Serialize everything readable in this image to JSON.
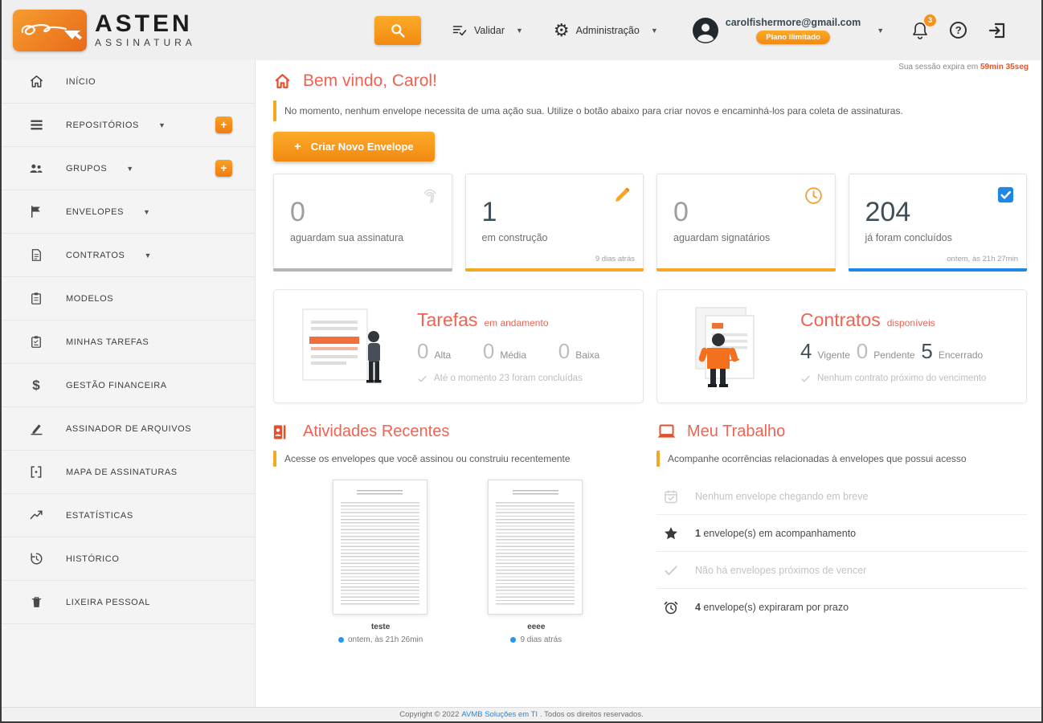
{
  "colors": {
    "accent_orange": "#f6921e",
    "title_salmon": "#ee6352",
    "status_blue": "#1e88e5",
    "notice_amber": "#f6a821",
    "muted_gray": "#bdbdbd"
  },
  "header": {
    "logo_brand": "ASTEN",
    "logo_sub": "ASSINATURA",
    "validar_label": "Validar",
    "admin_label": "Administração",
    "email": "carolfishermore@gmail.com",
    "plan_badge": "Plano Ilimitado",
    "notification_count": "3"
  },
  "sidebar": {
    "items": [
      {
        "label": "INÍCIO",
        "icon": "home-icon"
      },
      {
        "label": "REPOSITÓRIOS",
        "icon": "repositories-icon",
        "has_caret": true,
        "has_add": true
      },
      {
        "label": "GRUPOS",
        "icon": "groups-icon",
        "has_caret": true,
        "has_add": true
      },
      {
        "label": "ENVELOPES",
        "icon": "flag-icon",
        "has_caret": true
      },
      {
        "label": "CONTRATOS",
        "icon": "contract-icon",
        "has_caret": true
      },
      {
        "label": "MODELOS",
        "icon": "clipboard-icon"
      },
      {
        "label": "MINHAS TAREFAS",
        "icon": "tasks-icon"
      },
      {
        "label": "GESTÃO FINANCEIRA",
        "icon": "dollar-icon"
      },
      {
        "label": "ASSINADOR DE ARQUIVOS",
        "icon": "pen-icon"
      },
      {
        "label": "MAPA DE ASSINATURAS",
        "icon": "map-icon"
      },
      {
        "label": "ESTATÍSTICAS",
        "icon": "stats-icon"
      },
      {
        "label": "HISTÓRICO",
        "icon": "history-icon"
      },
      {
        "label": "LIXEIRA PESSOAL",
        "icon": "trash-icon"
      }
    ]
  },
  "main": {
    "session_prefix": "Sua sessão expira em ",
    "session_time": "59min 35seg",
    "welcome_title": "Bem vindo, Carol!",
    "notice": "No momento, nenhum envelope necessita de uma ação sua. Utilize o botão abaixo para criar novos e encaminhá-los para coleta de assinaturas.",
    "create_button_label": "Criar Novo Envelope",
    "stat_cards": [
      {
        "value": "0",
        "label": "aguardam sua assinatura",
        "icon": "fingerprint-icon",
        "accent": "#b5b5b5",
        "timestamp": ""
      },
      {
        "value": "1",
        "label": "em construção",
        "icon": "pencil-icon",
        "accent": "#f6a821",
        "timestamp": "9 dias atrás"
      },
      {
        "value": "0",
        "label": "aguardam signatários",
        "icon": "clock-icon",
        "accent": "#f6a821",
        "timestamp": ""
      },
      {
        "value": "204",
        "label": "já foram concluídos",
        "icon": "checkbox-icon",
        "accent": "#1e88e5",
        "timestamp": "ontem, às 21h 27min"
      }
    ],
    "tarefas": {
      "title": "Tarefas",
      "subtitle": "em andamento",
      "stats": [
        {
          "value": "0",
          "label": "Alta"
        },
        {
          "value": "0",
          "label": "Média"
        },
        {
          "value": "0",
          "label": "Baixa"
        }
      ],
      "footer_note": "Até o momento 23 foram concluídas"
    },
    "contratos": {
      "title": "Contratos",
      "subtitle": "disponíveis",
      "stats": [
        {
          "value": "4",
          "label": "Vigente"
        },
        {
          "value": "0",
          "label": "Pendente"
        },
        {
          "value": "5",
          "label": "Encerrado"
        }
      ],
      "footer_note": "Nenhum contrato próximo do vencimento"
    },
    "atividades": {
      "title": "Atividades Recentes",
      "subtitle": "Acesse os envelopes que você assinou ou construiu recentemente",
      "documents": [
        {
          "name": "teste",
          "timestamp": "ontem, às 21h 26min"
        },
        {
          "name": "eeee",
          "timestamp": "9 dias atrás"
        }
      ]
    },
    "meu_trabalho": {
      "title": "Meu Trabalho",
      "subtitle": "Acompanhe ocorrências relacionadas à envelopes que possui acesso",
      "items": [
        {
          "icon": "calendar-icon",
          "text": "Nenhum envelope chegando em breve",
          "muted": true
        },
        {
          "icon": "star-icon",
          "prefix": "1",
          "text": " envelope(s) em acompanhamento",
          "muted": false
        },
        {
          "icon": "check-icon",
          "text": "Não há envelopes próximos de vencer",
          "muted": true
        },
        {
          "icon": "alarm-icon",
          "prefix": "4",
          "text": " envelope(s) expiraram por prazo",
          "muted": false
        }
      ]
    }
  },
  "footer": {
    "prefix": "Copyright © 2022 ",
    "link": "AVMB Soluções em TI",
    "suffix": ". Todos os direitos reservados."
  }
}
